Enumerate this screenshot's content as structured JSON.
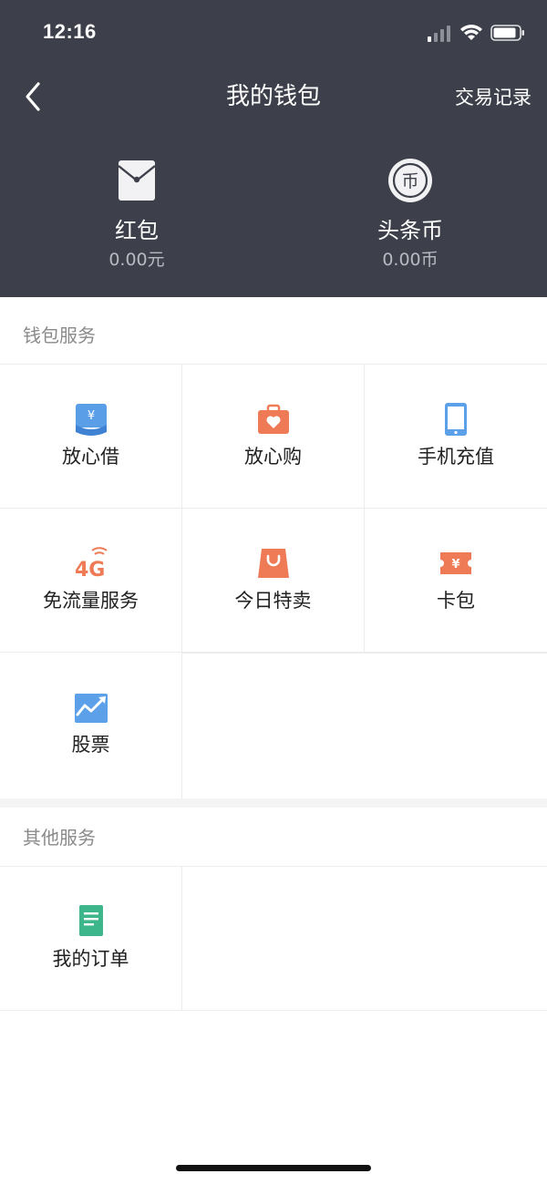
{
  "status_bar": {
    "time": "12:16"
  },
  "nav": {
    "title": "我的钱包",
    "action_label": "交易记录"
  },
  "balances": [
    {
      "label": "红包",
      "value": "0.00元",
      "icon": "red-envelope-icon"
    },
    {
      "label": "头条币",
      "value": "0.00币",
      "icon": "coin-icon"
    }
  ],
  "wallet_services": {
    "title": "钱包服务",
    "items": [
      {
        "label": "放心借",
        "icon": "loan-icon",
        "color": "#4a90e2"
      },
      {
        "label": "放心购",
        "icon": "shopping-bag-heart-icon",
        "color": "#ee7b55"
      },
      {
        "label": "手机充值",
        "icon": "phone-icon",
        "color": "#5ba0e8"
      },
      {
        "label": "免流量服务",
        "icon": "4g-icon",
        "color": "#ee7b55"
      },
      {
        "label": "今日特卖",
        "icon": "sale-bag-icon",
        "color": "#ee7b55"
      },
      {
        "label": "卡包",
        "icon": "ticket-icon",
        "color": "#ee7b55"
      },
      {
        "label": "股票",
        "icon": "stock-chart-icon",
        "color": "#5ba0e8"
      }
    ]
  },
  "other_services": {
    "title": "其他服务",
    "items": [
      {
        "label": "我的订单",
        "icon": "order-document-icon",
        "color": "#3db68b"
      }
    ]
  },
  "colors": {
    "header_bg": "#3d3f4a",
    "header_subtext": "#b8bac2",
    "divider": "#ececec",
    "section_title": "#8a8a8a"
  }
}
